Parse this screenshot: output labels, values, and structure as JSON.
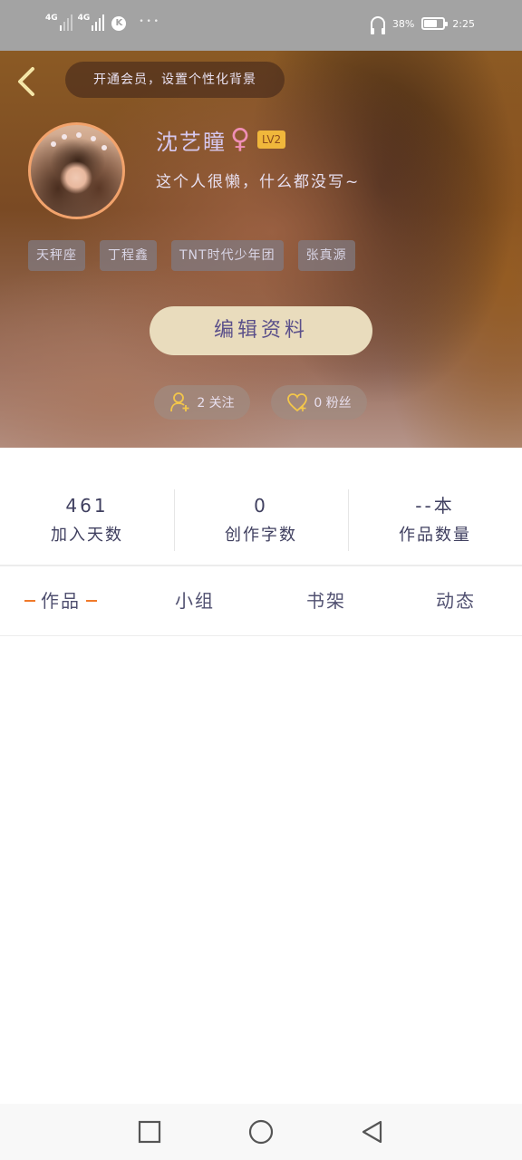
{
  "status_bar": {
    "net1": "4G",
    "net2": "4G",
    "app_icon": "K",
    "battery_percent": 0.7,
    "right_text_1": "38%",
    "right_text_2": "2:25"
  },
  "header": {
    "back_icon": "chevron-left-icon",
    "vip_text": "开通会员，设置个性化背景",
    "username": "沈艺瞳",
    "gender_icon": "♀",
    "level": "LV2",
    "bio": "这个人很懒，什么都没写~",
    "tags": [
      "天秤座",
      "丁程鑫",
      "TNT时代少年团",
      "张真源"
    ],
    "edit_button": "编辑资料",
    "follow_text": "2 关注",
    "fans_text": "0 粉丝"
  },
  "stats": [
    {
      "value": "461",
      "label": "加入天数"
    },
    {
      "value": "0",
      "label": "创作字数"
    },
    {
      "value": "--本",
      "label": "作品数量"
    }
  ],
  "tabs": {
    "works": "作品",
    "group": "小组",
    "shelf": "书架",
    "feed": "动态",
    "active_color": "#f07a2a"
  },
  "colors": {
    "accent_orange": "#f07a2a",
    "edit_button_bg": "#e9dcbd",
    "level_badge_bg": "#f0b73b"
  }
}
